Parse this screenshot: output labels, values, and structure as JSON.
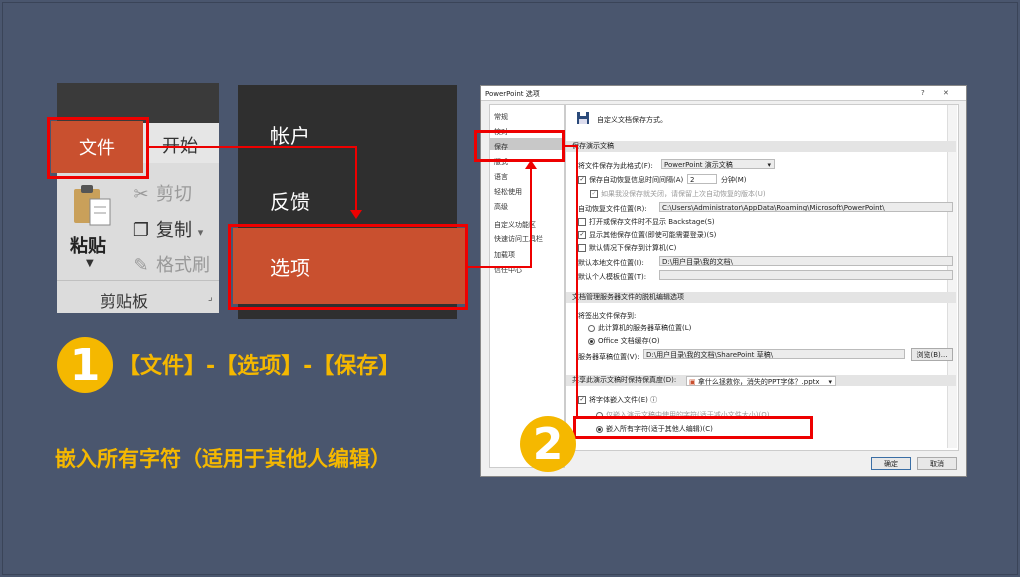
{
  "ribbon": {
    "file_tab": "文件",
    "home_tab": "开始",
    "paste": "粘贴",
    "paste_arrow": "▼",
    "cut": "剪切",
    "copy": "复制",
    "copy_arrow": "▾",
    "format_painter": "格式刷",
    "group_label": "剪贴板",
    "launcher": "⌟"
  },
  "backstage": {
    "account": "帐户",
    "feedback": "反馈",
    "options": "选项"
  },
  "steps": {
    "step1_number": "1",
    "step1_text": "【文件】-【选项】-【保存】",
    "step2_number": "2",
    "step2_text": "嵌入所有字符（适用于其他人编辑）"
  },
  "dialog": {
    "title": "PowerPoint 选项",
    "help": "?",
    "close": "✕",
    "nav": [
      "常规",
      "校对",
      "保存",
      "版式",
      "语言",
      "轻松使用",
      "高级",
      "自定义功能区",
      "快速访问工具栏",
      "加载项",
      "信任中心"
    ],
    "header": "自定义文档保存方式。",
    "sec1": "保存演示文稿",
    "format_label": "将文件保存为此格式(F):",
    "format_value": "PowerPoint 演示文稿",
    "autorecover_label": "保存自动恢复信息时间间隔(A)",
    "autorecover_value": "2",
    "minutes": "分钟(M)",
    "keep_last": "如果我没保存就关闭，请保留上次自动恢复的版本(U)",
    "autorecover_loc_label": "自动恢复文件位置(R):",
    "autorecover_loc_value": "C:\\Users\\Administrator\\AppData\\Roaming\\Microsoft\\PowerPoint\\",
    "no_backstage": "打开或保存文件时不显示 Backstage(S)",
    "show_other": "显示其他保存位置(即使可能需要登录)(S)",
    "default_computer": "默认情况下保存到计算机(C)",
    "default_local_label": "默认本地文件位置(I):",
    "default_local_value": "D:\\用户目录\\我的文档\\",
    "personal_template_label": "默认个人模板位置(T):",
    "personal_template_value": "",
    "sec2": "文档管理服务器文件的脱机编辑选项",
    "checkout_label": "将签出文件保存到:",
    "server_drafts": "此计算机的服务器草稿位置(L)",
    "office_cache": "Office 文档缓存(O)",
    "drafts_loc_label": "服务器草稿位置(V):",
    "drafts_loc_value": "D:\\用户目录\\我的文档\\SharePoint 草稿\\",
    "browse": "浏览(B)...",
    "sec3_label": "共享此演示文稿时保持保真度(D):",
    "sec3_file": "拿什么拯救你，消失的PPT字体？.pptx",
    "embed_fonts": "将字体嵌入文件(E)",
    "embed_used": "仅嵌入演示文稿中使用的字符(适于减小文件大小)(O)",
    "embed_all": "嵌入所有字符(适于其他人编辑)(C)",
    "ok": "确定",
    "cancel": "取消"
  }
}
